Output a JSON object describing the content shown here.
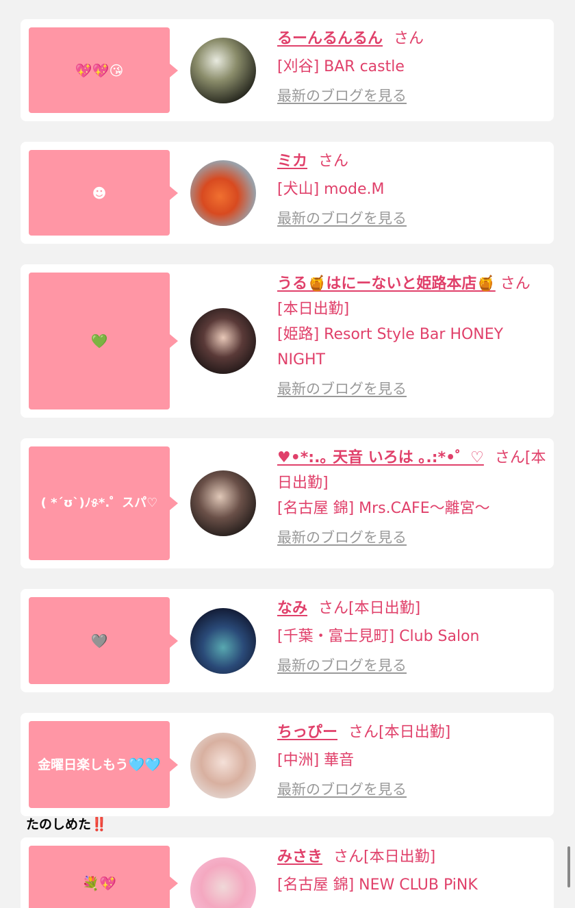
{
  "cards": [
    {
      "comment": "💖💖😘",
      "name": "るーんるんるん",
      "san": "さん",
      "tag": "",
      "area": "[刈谷] BAR castle",
      "blog_link": "最新のブログを見る"
    },
    {
      "comment": "☻",
      "name": "ミカ",
      "san": "さん",
      "tag": "",
      "area": "[犬山] mode.M",
      "blog_link": "最新のブログを見る"
    },
    {
      "comment": "💚",
      "name": "うる🍯はにーないと姫路本店🍯",
      "san": "さん",
      "tag": "[本日出勤]",
      "area": "[姫路] Resort Style Bar HONEY NIGHT",
      "blog_link": "最新のブログを見る"
    },
    {
      "comment": "( *´ʊ`)ﾉ୫*.゜スパ♡",
      "name": "♥•*:.｡ 天音 いろは ｡.:*•゜♡",
      "san": "さん",
      "tag": "[本日出勤]",
      "area": "[名古屋 錦] Mrs.CAFE〜離宮〜",
      "blog_link": "最新のブログを見る"
    },
    {
      "comment": "🩶",
      "name": "なみ",
      "san": "さん",
      "tag": "[本日出勤]",
      "area": "[千葉・富士見町] Club Salon",
      "blog_link": "最新のブログを見る"
    },
    {
      "comment": "金曜日楽しもう🩵🩵",
      "name": "ちっぴー",
      "san": "さん",
      "tag": "[本日出勤]",
      "area": "[中洲] 華音",
      "blog_link": "最新のブログを見る"
    },
    {
      "comment": "💐💖",
      "name": "みさき",
      "san": "さん",
      "tag": "[本日出勤]",
      "area": "[名古屋 錦] NEW CLUB PiNK",
      "blog_link": ""
    }
  ],
  "overflow_text": "たのしめた‼️",
  "colors": {
    "bubble": "#ff96a5",
    "accent": "#e0406a",
    "link_gray": "#999999",
    "page_bg": "#f2f2f2"
  }
}
